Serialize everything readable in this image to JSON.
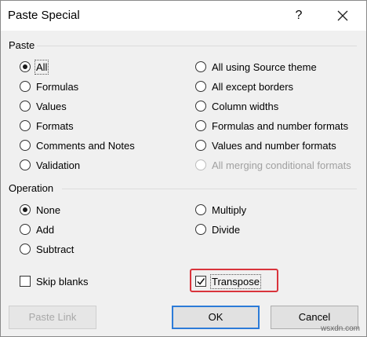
{
  "dialog": {
    "title": "Paste Special",
    "help_glyph": "?",
    "close_label": "Close"
  },
  "paste": {
    "group_label": "Paste",
    "left": [
      {
        "label": "All",
        "checked": true
      },
      {
        "label": "Formulas",
        "checked": false
      },
      {
        "label": "Values",
        "checked": false
      },
      {
        "label": "Formats",
        "checked": false
      },
      {
        "label": "Comments and Notes",
        "checked": false
      },
      {
        "label": "Validation",
        "checked": false
      }
    ],
    "right": [
      {
        "label": "All using Source theme",
        "checked": false
      },
      {
        "label": "All except borders",
        "checked": false
      },
      {
        "label": "Column widths",
        "checked": false
      },
      {
        "label": "Formulas and number formats",
        "checked": false
      },
      {
        "label": "Values and number formats",
        "checked": false
      },
      {
        "label": "All merging conditional formats",
        "checked": false,
        "disabled": true
      }
    ]
  },
  "operation": {
    "group_label": "Operation",
    "left": [
      {
        "label": "None",
        "checked": true
      },
      {
        "label": "Add",
        "checked": false
      },
      {
        "label": "Subtract",
        "checked": false
      }
    ],
    "right": [
      {
        "label": "Multiply",
        "checked": false
      },
      {
        "label": "Divide",
        "checked": false
      }
    ]
  },
  "checks": {
    "skip_blanks": {
      "label": "Skip blanks",
      "checked": false
    },
    "transpose": {
      "label": "Transpose",
      "checked": true
    }
  },
  "buttons": {
    "paste_link": "Paste Link",
    "ok": "OK",
    "cancel": "Cancel"
  },
  "colors": {
    "highlight": "#d9343c",
    "default_button_border": "#2c7bd8"
  },
  "watermark": "wsxdn.com"
}
